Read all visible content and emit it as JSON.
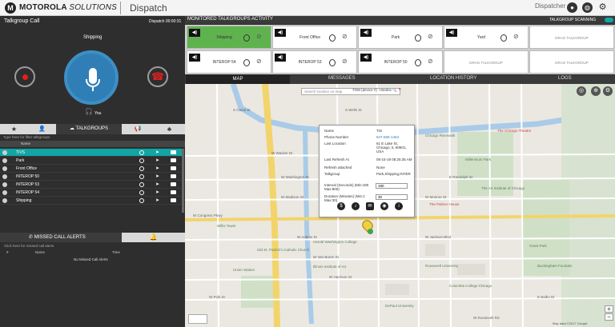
{
  "topbar": {
    "brand": "MOTOROLA",
    "brand_italic": "SOLUTIONS",
    "app_title": "Dispatch",
    "user_label": "Dispatcher",
    "logo_glyph": "M"
  },
  "call": {
    "title": "Talkgroup Call",
    "time": "Dispatch 00:00:31",
    "speaker": "Shipping",
    "headset_label": "You",
    "icons": [
      "record-icon",
      "mic-icon",
      "hangup-icon",
      "headset-icon"
    ]
  },
  "left_tabs": {
    "star": "★",
    "person": "👤",
    "talkgroups": "TALKGROUPS",
    "megaphone": "📢",
    "puzzle": "♣"
  },
  "talkgroup_list": {
    "filter_text": "Type here for filter talkgroups",
    "column_name": "Name",
    "rows": [
      {
        "name": "TIVS",
        "selected": true
      },
      {
        "name": "Park",
        "selected": false
      },
      {
        "name": "Front Office",
        "selected": false
      },
      {
        "name": "INTEROP 50",
        "selected": false
      },
      {
        "name": "INTEROP 53",
        "selected": false
      },
      {
        "name": "INTEROP 54",
        "selected": false
      },
      {
        "name": "Shipping",
        "selected": false
      }
    ]
  },
  "missed": {
    "title": "MISSED CALL ALERTS",
    "subtitle": "Click here for missed call alerts",
    "col_num": "#",
    "col_name": "Name",
    "col_time": "Time",
    "empty": "No Missed Call Alerts"
  },
  "monitor": {
    "title": "MONITORED TALKGROUPS ACTIVITY",
    "scanning_label": "TALKGROUP SCANNING",
    "tiles_row1": [
      {
        "name": "Shipping",
        "active": true,
        "empty": false
      },
      {
        "name": "Front Office",
        "active": false,
        "empty": false
      },
      {
        "name": "Park",
        "active": false,
        "empty": false
      },
      {
        "name": "Yard",
        "active": false,
        "empty": false
      },
      {
        "name": "DRAG TALKGROUP",
        "active": false,
        "empty": true
      }
    ],
    "tiles_row2": [
      {
        "name": "INTEROP 54",
        "active": false,
        "empty": false
      },
      {
        "name": "INTEROP 53",
        "active": false,
        "empty": false
      },
      {
        "name": "INTEROP 50",
        "active": false,
        "empty": false
      },
      {
        "name": "DRAG TALKGROUP",
        "active": false,
        "empty": true
      },
      {
        "name": "DRAG TALKGROUP",
        "active": false,
        "empty": true
      }
    ]
  },
  "map_tabs": {
    "map": "MAP",
    "messages": "MESSAGES",
    "location_history": "LOCATION HISTORY",
    "logs": "LOGS"
  },
  "map": {
    "search_placeholder": "Search location on map",
    "search_option": "TOM (device #)",
    "search_option2": "Hiredss",
    "footer": "Map data ©2017 Google",
    "streets": [
      "W Wacker Dr",
      "W Randolph St",
      "E Randolph St",
      "W Washington St",
      "W Madison St",
      "W Monroe St",
      "W Adams St",
      "W Jackson Blvd",
      "W Van Buren St",
      "W Congress Pkwy",
      "W Harrison St",
      "W Polk St",
      "S Canal St",
      "S Wells St",
      "E Balbo Dr",
      "W Roosevelt Rd"
    ],
    "poi": [
      "Millennium Park",
      "The Art Institute of Chicago",
      "Grant Park",
      "Chicago Riverwalk",
      "Old St. Patrick's Catholic Church",
      "The Chicago Theatre",
      "Willis Tower",
      "Union Station",
      "Harold Washington College",
      "Buckingham Fountain",
      "Roosevelt University",
      "DePaul University",
      "Illinois Institute of Art",
      "The Palmer House",
      "Columbia College Chicago"
    ],
    "popup": {
      "rows": [
        {
          "label": "Name",
          "value": "Tim"
        },
        {
          "label": "Phone Number",
          "value": "847-555-1463",
          "link": true
        },
        {
          "label": "Last Location",
          "value": "61 E Lake St, Chicago, IL 60601, USA"
        },
        {
          "label": "Last Refresh At",
          "value": "05-15-19 08:25:35 AM"
        },
        {
          "label": "Refresh attached",
          "value": "None"
        },
        {
          "label": "Talkgroup",
          "value": "Park,Shipping,INTER"
        },
        {
          "label": "Interval (Seconds) (Min:180 Max:900)",
          "value": "180",
          "input": true
        },
        {
          "label": "Duration (Minutes) (Min:1 Max:30)",
          "value": "30",
          "input": true
        }
      ]
    }
  },
  "colors": {
    "accent": "#11a5a5",
    "mic_blue": "#2f7fb6",
    "active_tile": "#5fb34f",
    "hangup_red": "#e02020"
  }
}
